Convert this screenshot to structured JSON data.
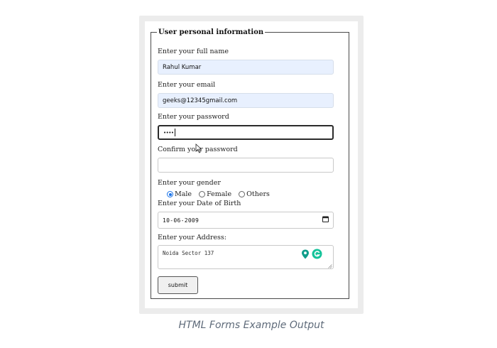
{
  "form": {
    "legend": "User personal information",
    "full_name": {
      "label": "Enter your full name",
      "value": "Rahul Kumar"
    },
    "email": {
      "label": "Enter your email",
      "value": "geeks@12345gmail.com"
    },
    "password": {
      "label": "Enter your password",
      "value": "••••"
    },
    "confirm_password": {
      "label": "Confirm your password",
      "value": ""
    },
    "gender": {
      "label": "Enter your gender",
      "options": [
        "Male",
        "Female",
        "Others"
      ],
      "selected": "Male"
    },
    "dob": {
      "label": "Enter your Date of Birth",
      "value": "10-06-2009"
    },
    "address": {
      "label": "Enter your Address:",
      "value": "Noida Sector 137"
    },
    "submit_label": "submit"
  },
  "icons": {
    "calendar": "calendar-icon",
    "location": "location-pin-icon",
    "grammarly": "grammarly-icon",
    "cursor": "mouse-cursor-icon",
    "resize": "resize-handle-icon"
  },
  "colors": {
    "autofill": "#e8f0fe",
    "radio_checked": "#1a73e8",
    "grammarly_green": "#15c39a",
    "pin_teal": "#0f9d8a",
    "caption": "#5f6b7a"
  },
  "caption": "HTML Forms Example Output"
}
